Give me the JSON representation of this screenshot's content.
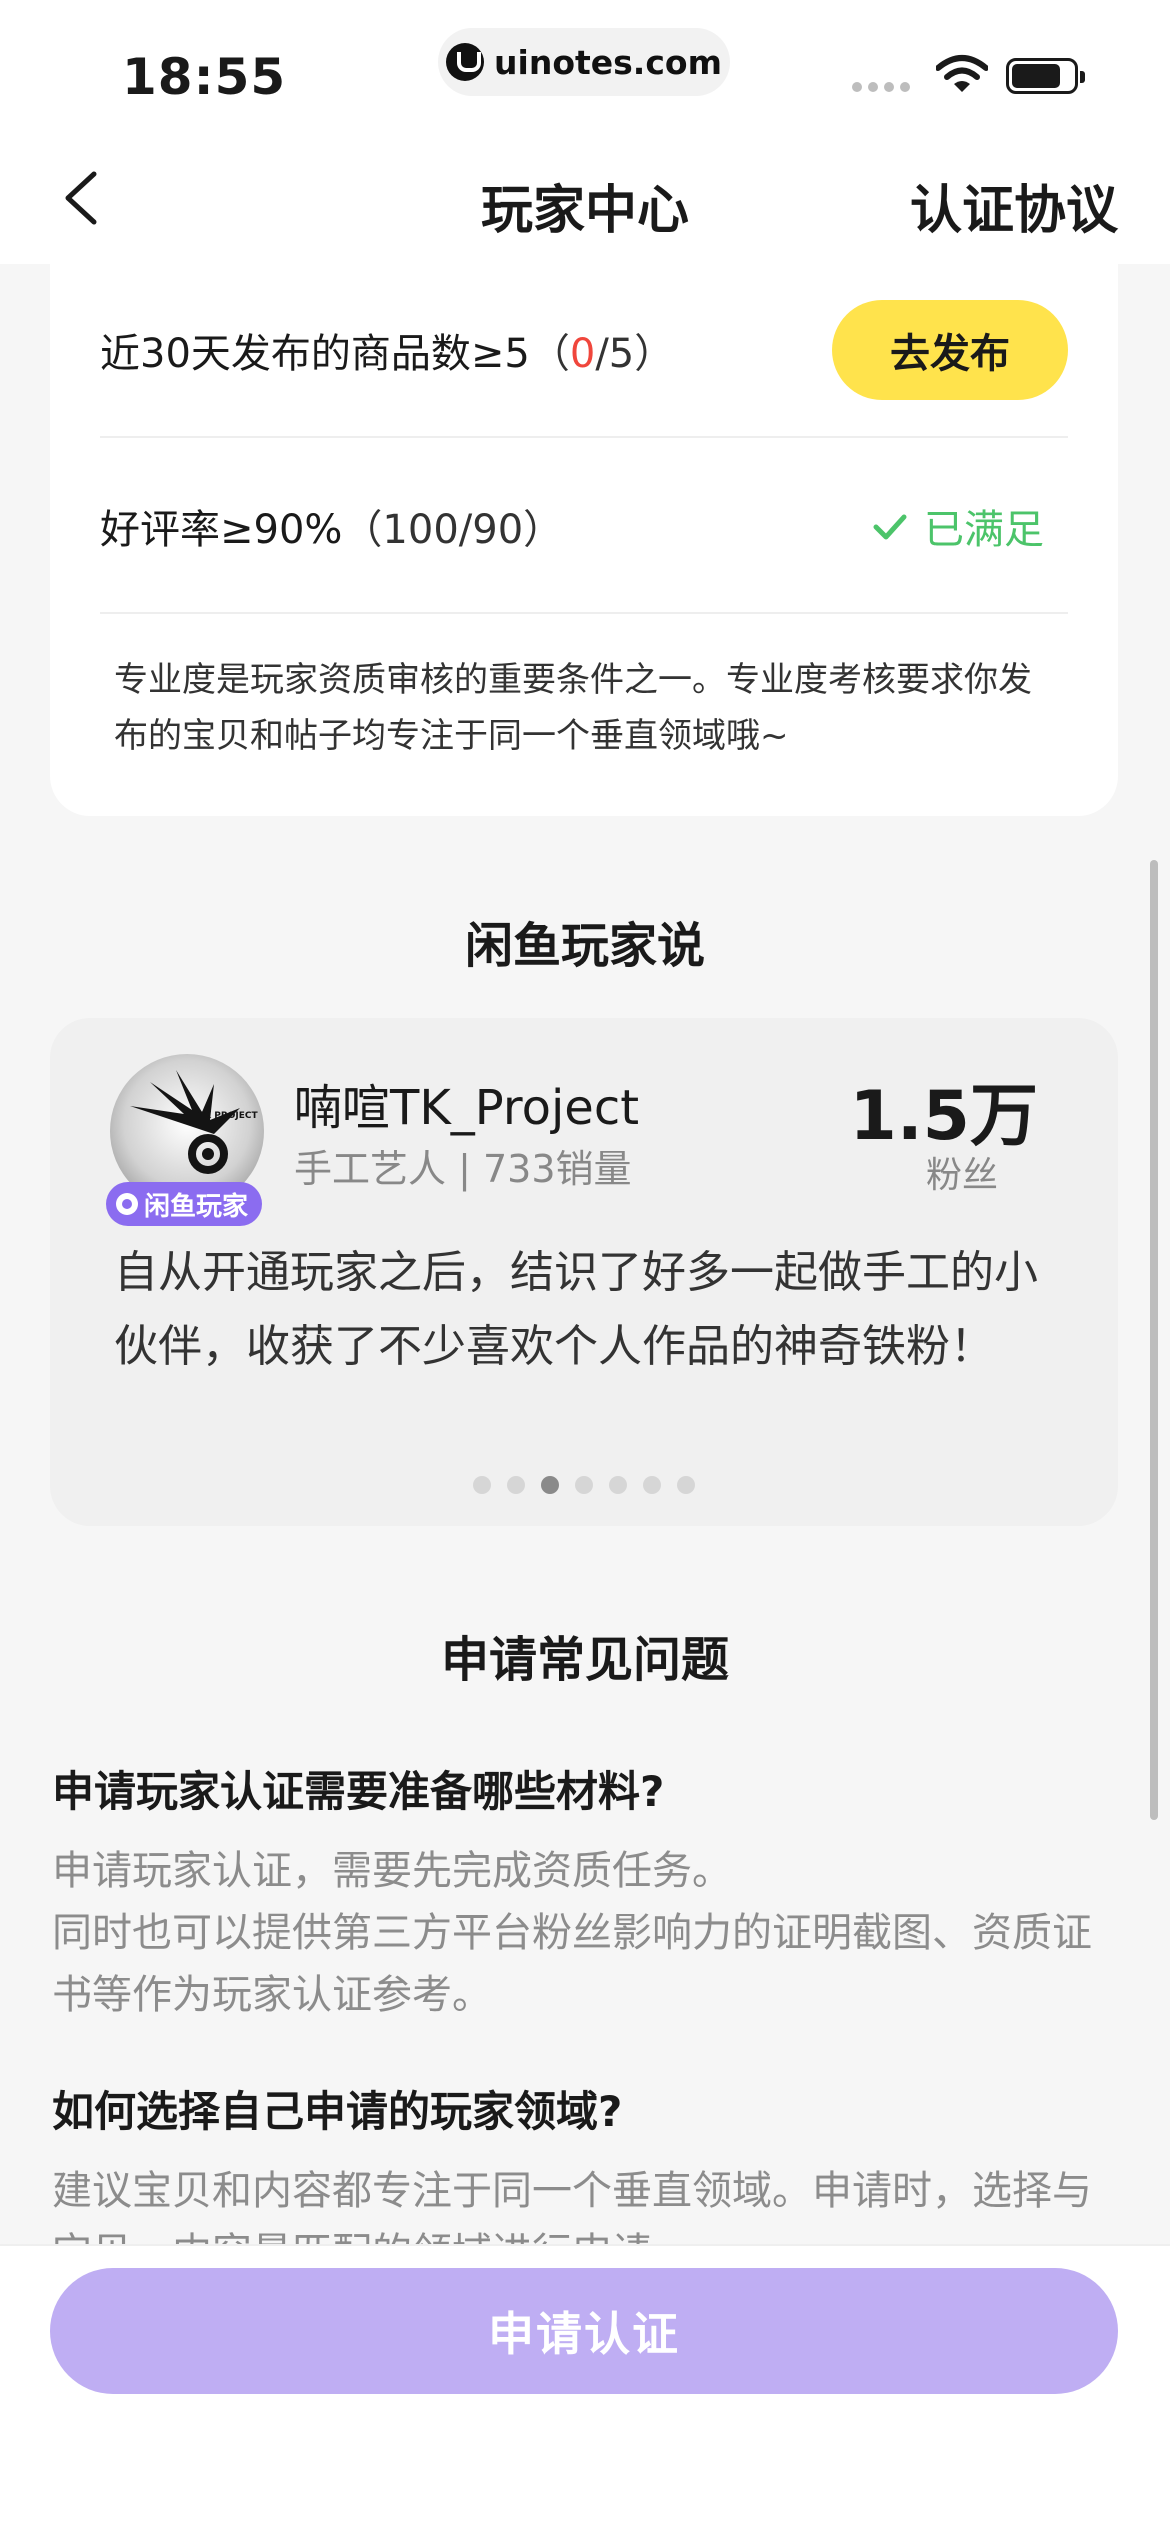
{
  "status_bar": {
    "time": "18:55",
    "url": "uinotes.com"
  },
  "nav": {
    "title": "玩家中心",
    "right_label": "认证协议"
  },
  "requirements": [
    {
      "label": "近30天发布的商品数≥5",
      "paren_open": "（",
      "current": "0",
      "sep": "/5）",
      "action": "去发布"
    },
    {
      "label": "好评率≥90%",
      "paren": "（100/90）",
      "status": "已满足"
    }
  ],
  "req_note": "专业度是玩家资质审核的重要条件之一。专业度考核要求你发布的宝贝和帖子均专注于同一个垂直领域哦~",
  "testimonial_section": {
    "title": "闲鱼玩家说",
    "avatar_text": "TK PROJECT",
    "badge": "闲鱼玩家",
    "name": "喃喧TK_Project",
    "subtitle": "手工艺人 | 733销量",
    "fans_count": "1.5万",
    "fans_label": "粉丝",
    "quote": "自从开通玩家之后，结识了好多一起做手工的小伙伴，收获了不少喜欢个人作品的神奇铁粉！",
    "total_slides": 7,
    "active_slide": 3
  },
  "faq": {
    "title": "申请常见问题",
    "items": [
      {
        "q": "申请玩家认证需要准备哪些材料?",
        "a1": "申请玩家认证，需要先完成资质任务。",
        "a2": "同时也可以提供第三方平台粉丝影响力的证明截图、资质证书等作为玩家认证参考。"
      },
      {
        "q": "如何选择自己申请的玩家领域?",
        "a1": "建议宝贝和内容都专注于同一个垂直领域。申请时，选择与宝贝、内容最匹配的领域进行申请。"
      }
    ]
  },
  "apply_button": "申请认证",
  "colors": {
    "accent_yellow": "#ffe34c",
    "purple": "#8b6cf0",
    "button_disabled": "#bfaef3",
    "success": "#4cc46a",
    "warn": "#f0463c"
  }
}
